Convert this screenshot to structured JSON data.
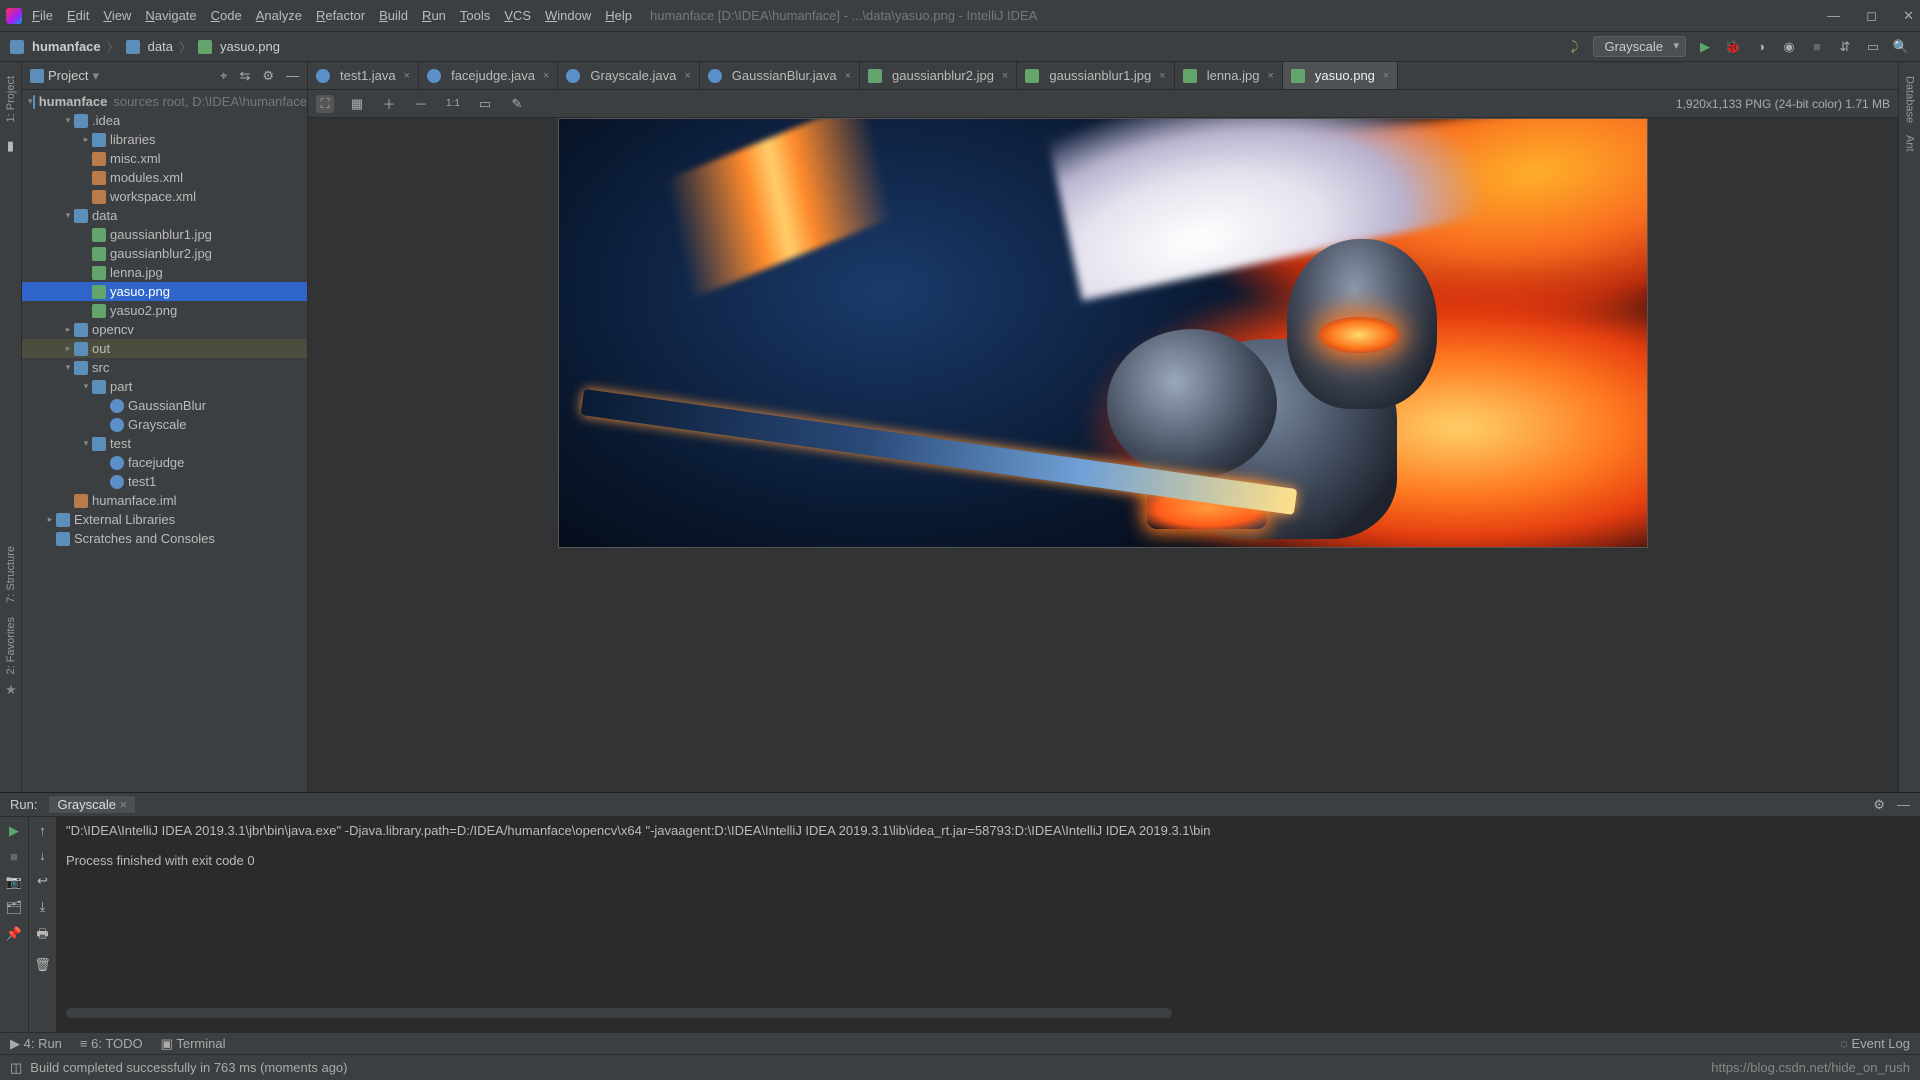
{
  "window": {
    "title": "humanface [D:\\IDEA\\humanface] - ...\\data\\yasuo.png - IntelliJ IDEA"
  },
  "menu": [
    "File",
    "Edit",
    "View",
    "Navigate",
    "Code",
    "Analyze",
    "Refactor",
    "Build",
    "Run",
    "Tools",
    "VCS",
    "Window",
    "Help"
  ],
  "breadcrumb": [
    "humanface",
    "data",
    "yasuo.png"
  ],
  "toolbar": {
    "run_config": "Grayscale"
  },
  "project": {
    "title": "Project",
    "root": {
      "name": "humanface",
      "hint": "sources root,  D:\\IDEA\\humanface"
    },
    "tree": [
      {
        "indent": 1,
        "arrow": "▾",
        "icon": "fold-blue",
        "label": ".idea"
      },
      {
        "indent": 2,
        "arrow": "▸",
        "icon": "fold-blue",
        "label": "libraries"
      },
      {
        "indent": 2,
        "arrow": "",
        "icon": "xml-ico",
        "label": "misc.xml"
      },
      {
        "indent": 2,
        "arrow": "",
        "icon": "xml-ico",
        "label": "modules.xml"
      },
      {
        "indent": 2,
        "arrow": "",
        "icon": "xml-ico",
        "label": "workspace.xml"
      },
      {
        "indent": 1,
        "arrow": "▾",
        "icon": "fold-blue",
        "label": "data"
      },
      {
        "indent": 2,
        "arrow": "",
        "icon": "imgico",
        "label": "gaussianblur1.jpg"
      },
      {
        "indent": 2,
        "arrow": "",
        "icon": "imgico",
        "label": "gaussianblur2.jpg"
      },
      {
        "indent": 2,
        "arrow": "",
        "icon": "imgico",
        "label": "lenna.jpg"
      },
      {
        "indent": 2,
        "arrow": "",
        "icon": "imgico",
        "label": "yasuo.png",
        "sel": true
      },
      {
        "indent": 2,
        "arrow": "",
        "icon": "imgico",
        "label": "yasuo2.png"
      },
      {
        "indent": 1,
        "arrow": "▸",
        "icon": "fold-blue",
        "label": "opencv"
      },
      {
        "indent": 1,
        "arrow": "▸",
        "icon": "fold-blue",
        "label": "out",
        "hl": true
      },
      {
        "indent": 1,
        "arrow": "▾",
        "icon": "fold-blue",
        "label": "src"
      },
      {
        "indent": 2,
        "arrow": "▾",
        "icon": "fold-blue",
        "label": "part"
      },
      {
        "indent": 3,
        "arrow": "",
        "icon": "java-ico",
        "label": "GaussianBlur"
      },
      {
        "indent": 3,
        "arrow": "",
        "icon": "java-ico",
        "label": "Grayscale"
      },
      {
        "indent": 2,
        "arrow": "▾",
        "icon": "fold-blue",
        "label": "test"
      },
      {
        "indent": 3,
        "arrow": "",
        "icon": "java-ico",
        "label": "facejudge"
      },
      {
        "indent": 3,
        "arrow": "",
        "icon": "java-ico",
        "label": "test1"
      },
      {
        "indent": 1,
        "arrow": "",
        "icon": "xml-ico",
        "label": "humanface.iml"
      },
      {
        "indent": 0,
        "arrow": "▸",
        "icon": "fold-blue",
        "label": "External Libraries"
      },
      {
        "indent": 0,
        "arrow": "",
        "icon": "fold-blue",
        "label": "Scratches and Consoles"
      }
    ]
  },
  "tabs": [
    {
      "icon": "java-ico",
      "label": "test1.java"
    },
    {
      "icon": "java-ico",
      "label": "facejudge.java"
    },
    {
      "icon": "java-ico",
      "label": "Grayscale.java"
    },
    {
      "icon": "java-ico",
      "label": "GaussianBlur.java"
    },
    {
      "icon": "imgico",
      "label": "gaussianblur2.jpg"
    },
    {
      "icon": "imgico",
      "label": "gaussianblur1.jpg"
    },
    {
      "icon": "imgico",
      "label": "lenna.jpg"
    },
    {
      "icon": "imgico",
      "label": "yasuo.png",
      "active": true
    }
  ],
  "image_info": "1,920x1,133 PNG (24-bit color) 1.71 MB",
  "run": {
    "label": "Run:",
    "tab": "Grayscale",
    "console_line1": "\"D:\\IDEA\\IntelliJ IDEA 2019.3.1\\jbr\\bin\\java.exe\" -Djava.library.path=D:/IDEA/humanface\\opencv\\x64 \"-javaagent:D:\\IDEA\\IntelliJ IDEA 2019.3.1\\lib\\idea_rt.jar=58793:D:\\IDEA\\IntelliJ IDEA 2019.3.1\\bin",
    "console_line2": "Process finished with exit code 0"
  },
  "toolstrip": {
    "run": "4: Run",
    "todo": "6: TODO",
    "terminal": "Terminal"
  },
  "status": {
    "msg": "Build completed successfully in 763 ms (moments ago)",
    "eventlog": "Event Log",
    "url": "https://blog.csdn.net/hide_on_rush"
  },
  "sidebars": {
    "left_project": "1: Project",
    "left_structure": "7: Structure",
    "left_fav": "2: Favorites",
    "right_db": "Database",
    "right_ant": "Ant"
  }
}
